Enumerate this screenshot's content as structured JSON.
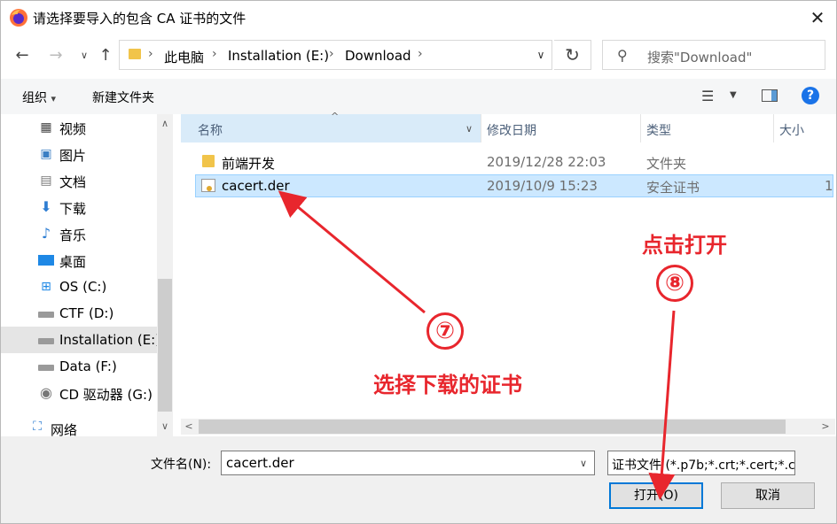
{
  "window": {
    "title": "请选择要导入的包含 CA 证书的文件",
    "close_symbol": "✕"
  },
  "address": {
    "crumbs": [
      "此电脑",
      "Installation (E:)",
      "Download"
    ],
    "search_placeholder": "搜索\"Download\""
  },
  "toolbar": {
    "organize": "组织",
    "new_folder": "新建文件夹",
    "help": "?"
  },
  "nav_pane": {
    "items": [
      {
        "label": "视频",
        "icon": "video-icon"
      },
      {
        "label": "图片",
        "icon": "pictures-icon"
      },
      {
        "label": "文档",
        "icon": "documents-icon"
      },
      {
        "label": "下载",
        "icon": "download-icon"
      },
      {
        "label": "音乐",
        "icon": "music-icon"
      },
      {
        "label": "桌面",
        "icon": "desktop-icon"
      },
      {
        "label": "OS (C:)",
        "icon": "windows-drive-icon"
      },
      {
        "label": "CTF (D:)",
        "icon": "drive-icon"
      },
      {
        "label": "Installation (E:)",
        "icon": "drive-icon",
        "selected": true
      },
      {
        "label": "Data (F:)",
        "icon": "drive-icon"
      },
      {
        "label": "CD 驱动器 (G:)",
        "icon": "cd-drive-icon"
      },
      {
        "label": "网络",
        "icon": "network-icon"
      }
    ]
  },
  "file_list": {
    "columns": [
      "名称",
      "修改日期",
      "类型",
      "大小"
    ],
    "rows": [
      {
        "name": "前端开发",
        "date": "2019/12/28 22:03",
        "type": "文件夹",
        "size": "",
        "icon": "folder-icon"
      },
      {
        "name": "cacert.der",
        "date": "2019/10/9 15:23",
        "type": "安全证书",
        "size": "1",
        "icon": "certificate-icon",
        "selected": true
      }
    ]
  },
  "bottom": {
    "filename_label": "文件名(N):",
    "filename_value": "cacert.der",
    "filter_value": "证书文件 (*.p7b;*.crt;*.cert;*.c",
    "open_button": "打开(O)",
    "cancel_button": "取消"
  },
  "annotations": {
    "step7_number": "⑦",
    "step7_text": "选择下载的证书",
    "step8_number": "⑧",
    "step8_text": "点击打开",
    "color": "#e8262d"
  }
}
